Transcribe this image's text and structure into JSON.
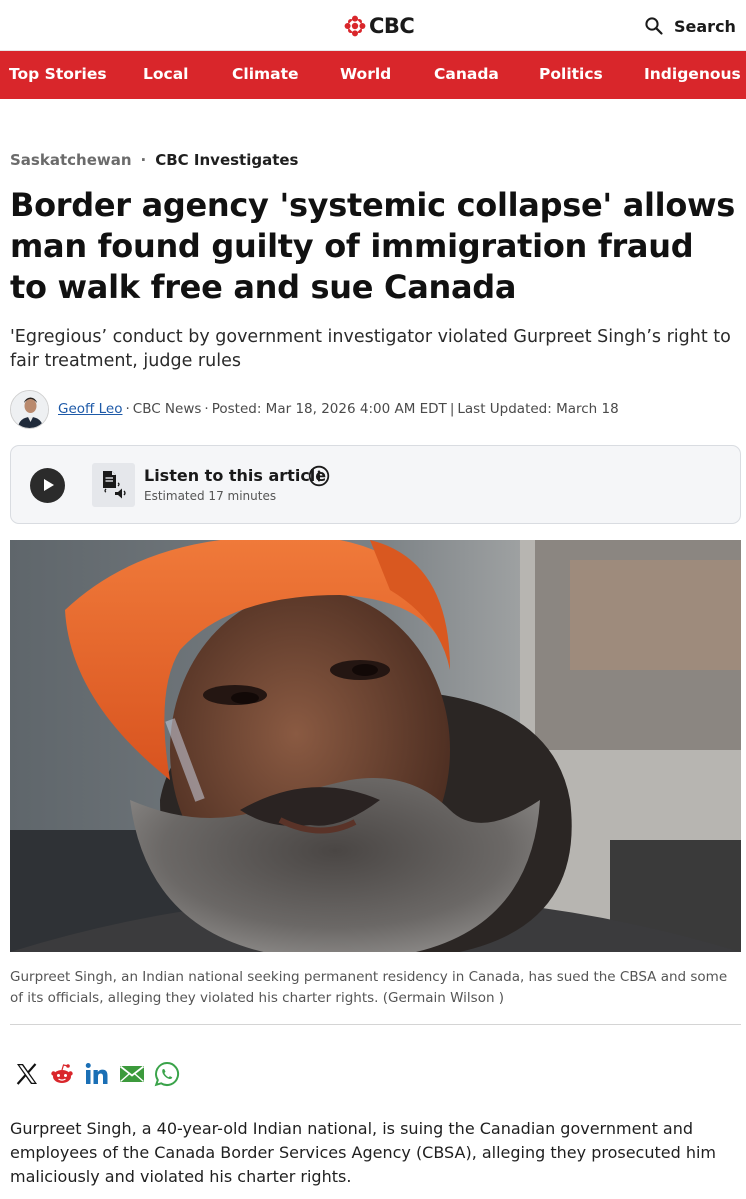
{
  "brand": {
    "logo_text": "CBC",
    "accent_color": "#d9262b"
  },
  "header": {
    "search_label": "Search",
    "search_icon": "search-icon"
  },
  "nav": {
    "items": [
      {
        "label": "Top Stories"
      },
      {
        "label": "Local"
      },
      {
        "label": "Climate"
      },
      {
        "label": "World"
      },
      {
        "label": "Canada"
      },
      {
        "label": "Politics"
      },
      {
        "label": "Indigenous"
      }
    ]
  },
  "article": {
    "breadcrumb": {
      "section": "Saskatchewan",
      "separator": "·",
      "subsection": "CBC Investigates"
    },
    "headline": "Border agency 'systemic collapse' allows man found guilty of immigration fraud to walk free and sue Canada",
    "deck": "'Egregious’ conduct by government investigator violated Gurpreet Singh’s right to fair treatment, judge rules",
    "byline": {
      "author": "Geoff Leo",
      "outlet": "CBC News",
      "posted": "Posted: Mar 18, 2026 4:00 AM EDT",
      "updated": "Last Updated: March 18",
      "dot": "·",
      "pipe": "|"
    },
    "listen": {
      "title": "Listen to this article",
      "estimate": "Estimated 17 minutes"
    },
    "caption": "Gurpreet Singh, an Indian national seeking permanent residency in Canada, has sued the CBSA and some of its officials, alleging they violated his charter rights. (Germain Wilson )",
    "share": [
      "x-icon",
      "reddit-icon",
      "linkedin-icon",
      "email-icon",
      "whatsapp-icon"
    ],
    "first_paragraph": "Gurpreet Singh, a 40-year-old Indian national, is suing the Canadian government and employees of the Canada Border Services Agency (CBSA), alleging they prosecuted him maliciously and violated his charter rights."
  }
}
